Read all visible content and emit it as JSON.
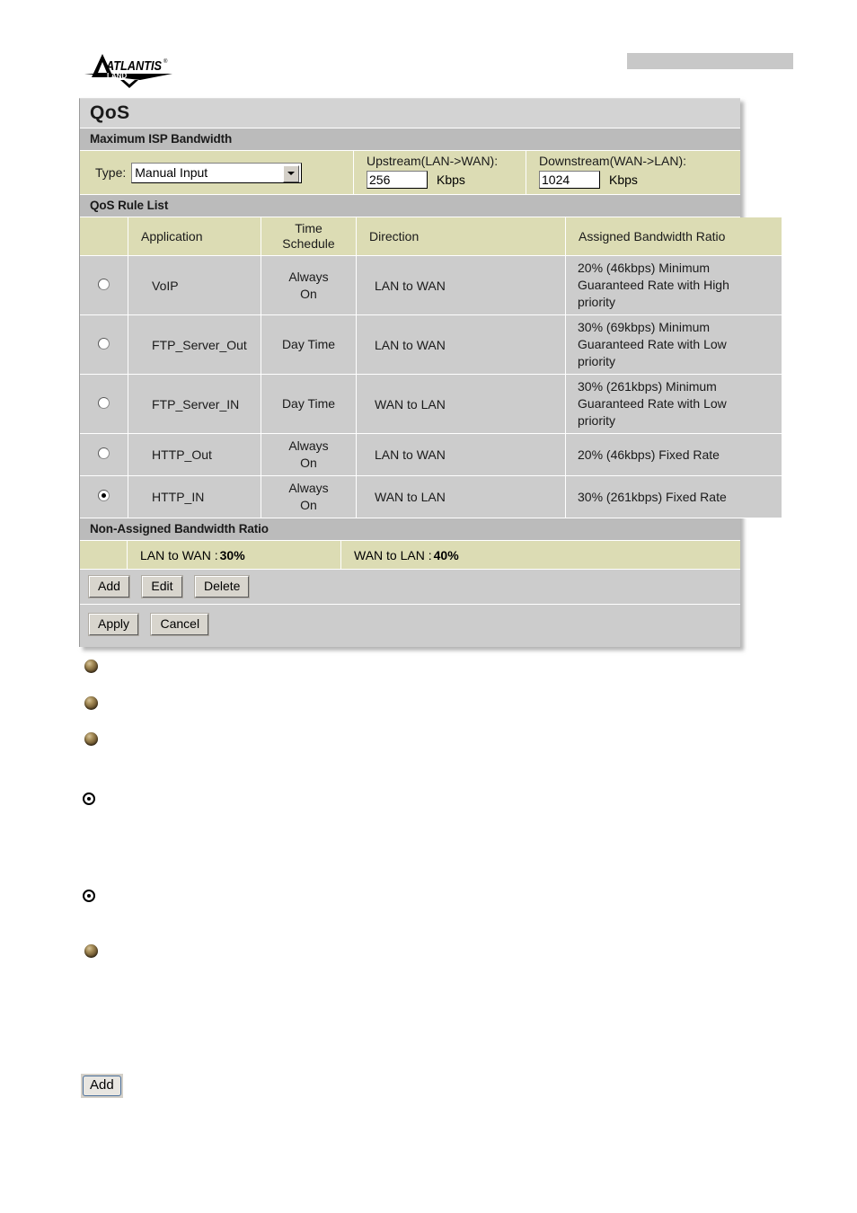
{
  "header": {
    "logo_primary": "ATLANTIS",
    "logo_trademark": "®",
    "logo_secondary": "LAND"
  },
  "panel": {
    "title": "QoS",
    "sections": {
      "bandwidth_head": "Maximum ISP Bandwidth",
      "rule_list_head": "QoS Rule List",
      "non_assigned_head": "Non-Assigned Bandwidth Ratio"
    }
  },
  "bandwidth": {
    "type_label": "Type:",
    "type_value": "Manual Input",
    "type_options": [
      "Manual Input"
    ],
    "upstream_label": "Upstream(LAN->WAN):",
    "upstream_value": "256",
    "upstream_unit": "Kbps",
    "downstream_label": "Downstream(WAN->LAN):",
    "downstream_value": "1024",
    "downstream_unit": "Kbps"
  },
  "rule_table": {
    "columns": {
      "select": "",
      "application": "Application",
      "time_schedule_line1": "Time",
      "time_schedule_line2": "Schedule",
      "direction": "Direction",
      "ratio": "Assigned Bandwidth Ratio"
    },
    "rows": [
      {
        "selected": false,
        "application": "VoIP",
        "time_schedule_line1": "Always",
        "time_schedule_line2": "On",
        "direction": "LAN to WAN",
        "ratio_line1": "20% (46kbps) Minimum",
        "ratio_line2": "Guaranteed Rate with High",
        "ratio_line3": "priority"
      },
      {
        "selected": false,
        "application": "FTP_Server_Out",
        "time_schedule_line1": "Day Time",
        "time_schedule_line2": "",
        "direction": "LAN to WAN",
        "ratio_line1": "30% (69kbps) Minimum",
        "ratio_line2": "Guaranteed Rate with Low",
        "ratio_line3": "priority"
      },
      {
        "selected": false,
        "application": "FTP_Server_IN",
        "time_schedule_line1": "Day Time",
        "time_schedule_line2": "",
        "direction": "WAN to LAN",
        "ratio_line1": "30% (261kbps) Minimum",
        "ratio_line2": "Guaranteed Rate with Low",
        "ratio_line3": "priority"
      },
      {
        "selected": false,
        "application": "HTTP_Out",
        "time_schedule_line1": "Always",
        "time_schedule_line2": "On",
        "direction": "LAN to WAN",
        "ratio_line1": "20% (46kbps) Fixed Rate",
        "ratio_line2": "",
        "ratio_line3": ""
      },
      {
        "selected": true,
        "application": "HTTP_IN",
        "time_schedule_line1": "Always",
        "time_schedule_line2": "On",
        "direction": "WAN to LAN",
        "ratio_line1": "30% (261kbps) Fixed Rate",
        "ratio_line2": "",
        "ratio_line3": ""
      }
    ]
  },
  "non_assigned": {
    "lan_to_wan_label": "LAN to WAN :",
    "lan_to_wan_value": "30%",
    "wan_to_lan_label": "WAN to LAN :",
    "wan_to_lan_value": "40%"
  },
  "buttons": {
    "add": "Add",
    "edit": "Edit",
    "delete": "Delete",
    "apply": "Apply",
    "cancel": "Cancel"
  },
  "inline_reference": {
    "add_button": "Add"
  },
  "colors": {
    "panel_bg": "#cccccc",
    "section_head": "#bbbbbb",
    "title_bar": "#d3d3d3",
    "beige": "#dcdcb4",
    "header_bar": "#c8c8c8"
  }
}
